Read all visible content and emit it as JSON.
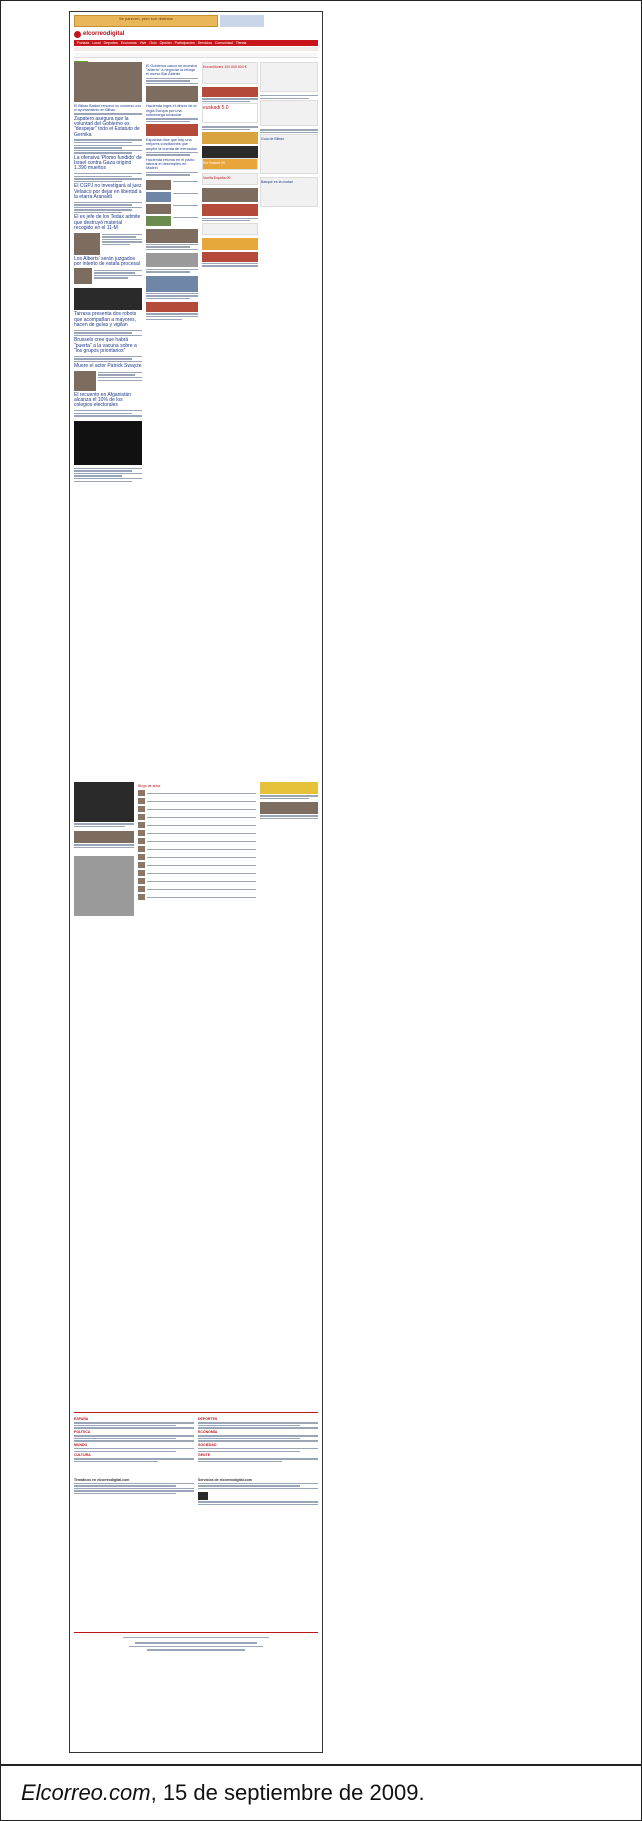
{
  "caption": {
    "site": "Elcorreo.com",
    "date": ", 15 de septiembre de 2009."
  },
  "page": {
    "logo": "elcorreodigital",
    "top_banner": "Se parecen, pero son distintos",
    "nav_items": [
      "Portada",
      "Local",
      "Deportes",
      "Economía",
      "Vivir",
      "Ocio",
      "Opinión",
      "Participación",
      "Servicios",
      "Comunidad",
      "Tienda"
    ],
    "headlines": {
      "main_1": "El Bilbao Basket renuevó su convenio con el ayuntamiento en Bilbao",
      "main_2": "Zapatero asegura que la voluntad del Gobierno es \"despejar\" todo el Estatuto de Gernika",
      "main_3": "La ofensiva 'Plomo fundido' de Israel contra Gaza originó 1.390 muertos",
      "main_4": "El CGPJ no investigará al juez Velasco por dejar en libertad a la etarra Aranaldi",
      "main_5": "El ex jefe de los Tedax admite que destruyó material recogido en el 11-M",
      "main_6": "Los Alberts' serán juzgados por intento de estafa procesal",
      "main_7": "Tarrasa presenta dos robots que acompañan a mayores, hacen de guías y vigilan",
      "main_8": "Brussels cree que habrá \"puerta\" a la vacuna sobre a \"los grupos prioritarios\"",
      "main_9": "Muere el actor Patrick Swayze",
      "main_10": "El recuento en Afganistán alcanza el 10% de los colegios electorales",
      "mid_1": "El Gobierno vasco se muestra \"abierto\" a negociar la rebaja el nuevo Bar Abierto",
      "mid_2": "Hacienda logra el dinero de la regla Europa por una sobrecarga muscular",
      "mid_3": "Espaldas dice que hay una mejores condiciones que amplíe la cuenta de mercados",
      "mid_4": "Hacienda retoma en el pacto laboral el desempleo en Madrid",
      "right_1": "Euromillones 100.000.000 €",
      "right_2": "euskadi 5.0",
      "right_3": "Eur Basket 09",
      "right_4": "Vuelta España 09",
      "right_5": "Guía de Bilbao",
      "right_6": "Basque en la ciudad"
    },
    "blogs_title": "Blogs de autor",
    "footer_sections": [
      "ESPAÑA",
      "DEPORTES",
      "POLÍTICA",
      "ECONOMÍA",
      "MUNDO",
      "SOCIEDAD",
      "CULTURA",
      "GENTE"
    ],
    "services_title": "Servicios de elcorreodigital.com",
    "themes_title": "Temáticos en elcorreodigital.com"
  }
}
